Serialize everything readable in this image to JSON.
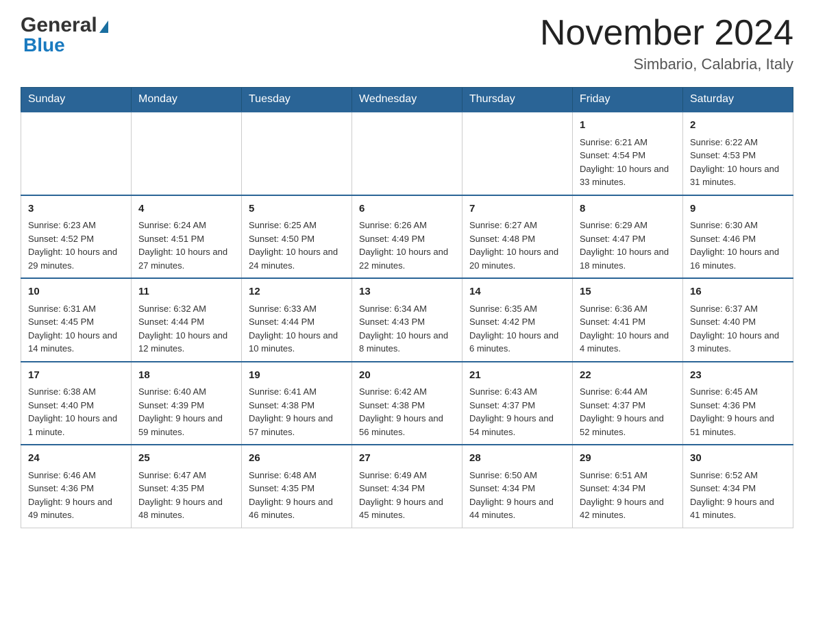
{
  "header": {
    "month_title": "November 2024",
    "subtitle": "Simbario, Calabria, Italy",
    "logo_general": "General",
    "logo_blue": "Blue"
  },
  "days_of_week": [
    "Sunday",
    "Monday",
    "Tuesday",
    "Wednesday",
    "Thursday",
    "Friday",
    "Saturday"
  ],
  "weeks": [
    {
      "days": [
        {
          "number": "",
          "info": ""
        },
        {
          "number": "",
          "info": ""
        },
        {
          "number": "",
          "info": ""
        },
        {
          "number": "",
          "info": ""
        },
        {
          "number": "",
          "info": ""
        },
        {
          "number": "1",
          "info": "Sunrise: 6:21 AM\nSunset: 4:54 PM\nDaylight: 10 hours and 33 minutes."
        },
        {
          "number": "2",
          "info": "Sunrise: 6:22 AM\nSunset: 4:53 PM\nDaylight: 10 hours and 31 minutes."
        }
      ]
    },
    {
      "days": [
        {
          "number": "3",
          "info": "Sunrise: 6:23 AM\nSunset: 4:52 PM\nDaylight: 10 hours and 29 minutes."
        },
        {
          "number": "4",
          "info": "Sunrise: 6:24 AM\nSunset: 4:51 PM\nDaylight: 10 hours and 27 minutes."
        },
        {
          "number": "5",
          "info": "Sunrise: 6:25 AM\nSunset: 4:50 PM\nDaylight: 10 hours and 24 minutes."
        },
        {
          "number": "6",
          "info": "Sunrise: 6:26 AM\nSunset: 4:49 PM\nDaylight: 10 hours and 22 minutes."
        },
        {
          "number": "7",
          "info": "Sunrise: 6:27 AM\nSunset: 4:48 PM\nDaylight: 10 hours and 20 minutes."
        },
        {
          "number": "8",
          "info": "Sunrise: 6:29 AM\nSunset: 4:47 PM\nDaylight: 10 hours and 18 minutes."
        },
        {
          "number": "9",
          "info": "Sunrise: 6:30 AM\nSunset: 4:46 PM\nDaylight: 10 hours and 16 minutes."
        }
      ]
    },
    {
      "days": [
        {
          "number": "10",
          "info": "Sunrise: 6:31 AM\nSunset: 4:45 PM\nDaylight: 10 hours and 14 minutes."
        },
        {
          "number": "11",
          "info": "Sunrise: 6:32 AM\nSunset: 4:44 PM\nDaylight: 10 hours and 12 minutes."
        },
        {
          "number": "12",
          "info": "Sunrise: 6:33 AM\nSunset: 4:44 PM\nDaylight: 10 hours and 10 minutes."
        },
        {
          "number": "13",
          "info": "Sunrise: 6:34 AM\nSunset: 4:43 PM\nDaylight: 10 hours and 8 minutes."
        },
        {
          "number": "14",
          "info": "Sunrise: 6:35 AM\nSunset: 4:42 PM\nDaylight: 10 hours and 6 minutes."
        },
        {
          "number": "15",
          "info": "Sunrise: 6:36 AM\nSunset: 4:41 PM\nDaylight: 10 hours and 4 minutes."
        },
        {
          "number": "16",
          "info": "Sunrise: 6:37 AM\nSunset: 4:40 PM\nDaylight: 10 hours and 3 minutes."
        }
      ]
    },
    {
      "days": [
        {
          "number": "17",
          "info": "Sunrise: 6:38 AM\nSunset: 4:40 PM\nDaylight: 10 hours and 1 minute."
        },
        {
          "number": "18",
          "info": "Sunrise: 6:40 AM\nSunset: 4:39 PM\nDaylight: 9 hours and 59 minutes."
        },
        {
          "number": "19",
          "info": "Sunrise: 6:41 AM\nSunset: 4:38 PM\nDaylight: 9 hours and 57 minutes."
        },
        {
          "number": "20",
          "info": "Sunrise: 6:42 AM\nSunset: 4:38 PM\nDaylight: 9 hours and 56 minutes."
        },
        {
          "number": "21",
          "info": "Sunrise: 6:43 AM\nSunset: 4:37 PM\nDaylight: 9 hours and 54 minutes."
        },
        {
          "number": "22",
          "info": "Sunrise: 6:44 AM\nSunset: 4:37 PM\nDaylight: 9 hours and 52 minutes."
        },
        {
          "number": "23",
          "info": "Sunrise: 6:45 AM\nSunset: 4:36 PM\nDaylight: 9 hours and 51 minutes."
        }
      ]
    },
    {
      "days": [
        {
          "number": "24",
          "info": "Sunrise: 6:46 AM\nSunset: 4:36 PM\nDaylight: 9 hours and 49 minutes."
        },
        {
          "number": "25",
          "info": "Sunrise: 6:47 AM\nSunset: 4:35 PM\nDaylight: 9 hours and 48 minutes."
        },
        {
          "number": "26",
          "info": "Sunrise: 6:48 AM\nSunset: 4:35 PM\nDaylight: 9 hours and 46 minutes."
        },
        {
          "number": "27",
          "info": "Sunrise: 6:49 AM\nSunset: 4:34 PM\nDaylight: 9 hours and 45 minutes."
        },
        {
          "number": "28",
          "info": "Sunrise: 6:50 AM\nSunset: 4:34 PM\nDaylight: 9 hours and 44 minutes."
        },
        {
          "number": "29",
          "info": "Sunrise: 6:51 AM\nSunset: 4:34 PM\nDaylight: 9 hours and 42 minutes."
        },
        {
          "number": "30",
          "info": "Sunrise: 6:52 AM\nSunset: 4:34 PM\nDaylight: 9 hours and 41 minutes."
        }
      ]
    }
  ]
}
